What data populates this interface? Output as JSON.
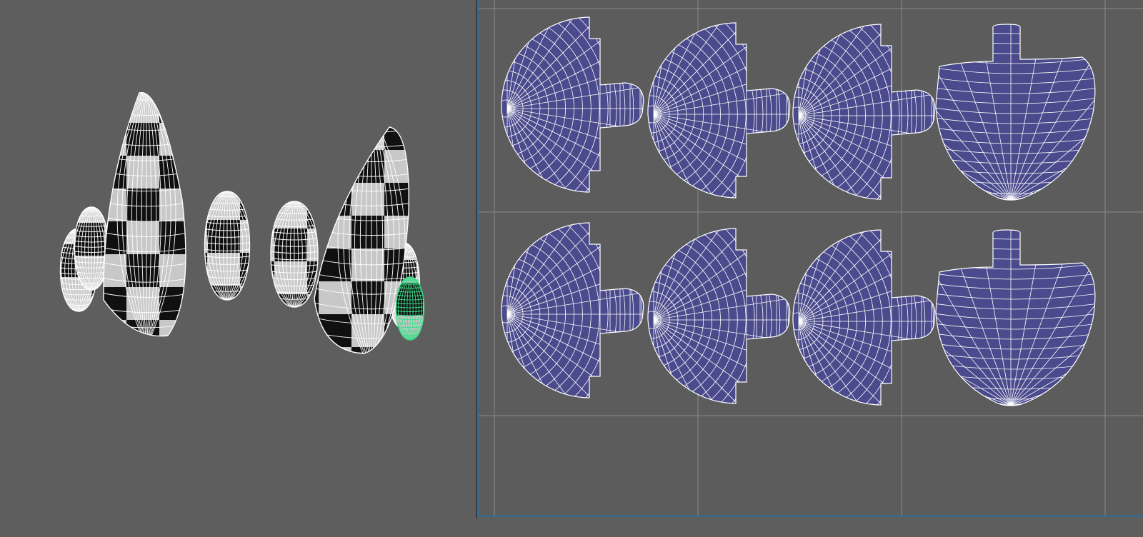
{
  "viewport_3d": {
    "background": "#5e5e5e",
    "wire_color": "#ffffff",
    "check_light": "#c8c8c8",
    "check_dark": "#101010",
    "selection_color": "#3ddc8a",
    "objects": [
      "tooth",
      "tooth",
      "tooth",
      "tooth",
      "tooth",
      "tooth",
      "tooth",
      "tooth"
    ],
    "selected_index": 7
  },
  "uv_editor": {
    "background": "#5c5c5c",
    "border_color": "#2e6e98",
    "grid_color": "#8a8a8a",
    "shell_fill": "#4a4a8c",
    "shell_wire": "#ffffff",
    "shell_rows": 2,
    "shell_cols": 4
  }
}
